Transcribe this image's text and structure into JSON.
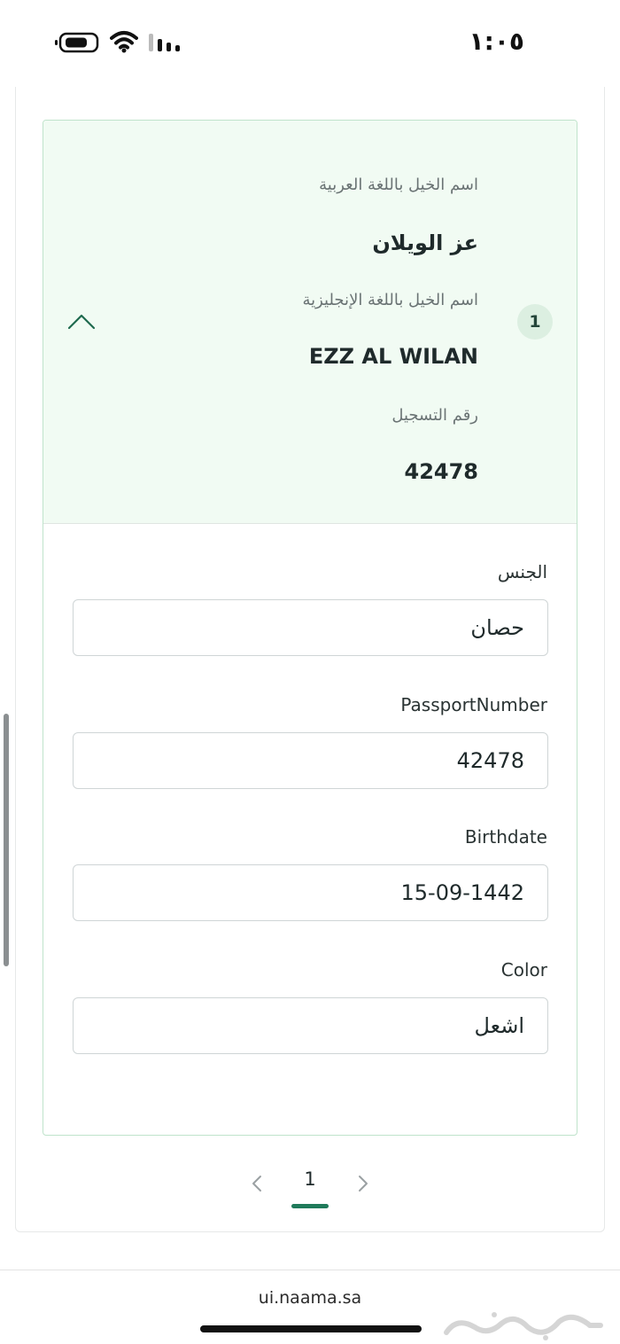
{
  "status_bar": {
    "time": "١:٠٥"
  },
  "accordion": {
    "index": "1",
    "arabic_name_label": "اسم الخيل باللغة العربية",
    "arabic_name_value": "عز الويلان",
    "english_name_label": "اسم الخيل باللغة الإنجليزية",
    "english_name_value": "EZZ AL WILAN",
    "registration_label": "رقم التسجيل",
    "registration_value": "42478",
    "expanded": true
  },
  "fields": {
    "gender": {
      "label": "الجنس",
      "value": "حصان"
    },
    "passport": {
      "label": "PassportNumber",
      "value": "42478"
    },
    "birthdate": {
      "label": "Birthdate",
      "value": "15-09-1442"
    },
    "color": {
      "label": "Color",
      "value": "اشعل"
    }
  },
  "pagination": {
    "current_page": "1"
  },
  "browser": {
    "url": "ui.naama.sa"
  },
  "watermark": {
    "text": "حراج"
  },
  "colors": {
    "accent": "#1f7a5a",
    "header_bg": "#f1fbf3",
    "card_border": "#bfe3cb"
  }
}
